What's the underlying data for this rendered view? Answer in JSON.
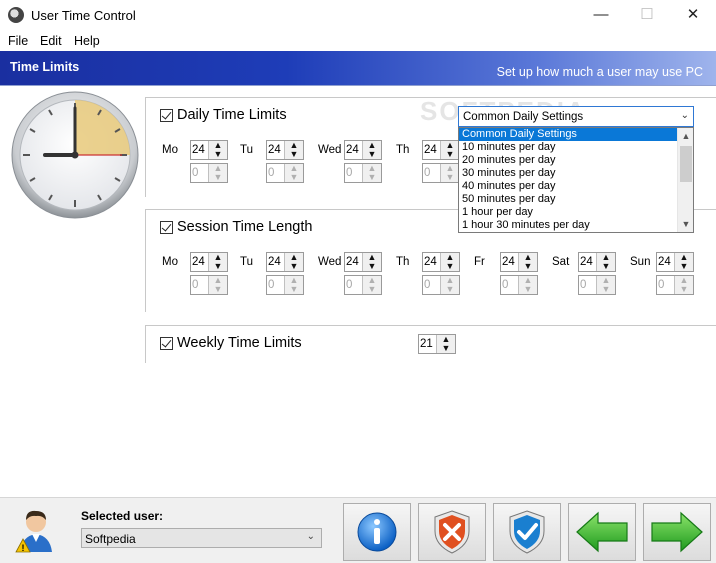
{
  "window": {
    "title": "User Time Control",
    "min_glyph": "—",
    "max_glyph": "☐",
    "close_glyph": "✕"
  },
  "menu": [
    {
      "label": "File"
    },
    {
      "label": "Edit"
    },
    {
      "label": "Help"
    }
  ],
  "header": {
    "title": "Time Limits",
    "subtitle": "Set up how much a user may use PC"
  },
  "watermark": "SOFTPEDIA",
  "daily": {
    "label": "Daily Time Limits",
    "checked": true,
    "days": [
      {
        "label": "Mo",
        "hours": "24",
        "minutes": "0"
      },
      {
        "label": "Tu",
        "hours": "24",
        "minutes": "0"
      },
      {
        "label": "Wed",
        "hours": "24",
        "minutes": "0"
      },
      {
        "label": "Th",
        "hours": "24",
        "minutes": "0"
      }
    ],
    "preset": {
      "value": "Common Daily Settings",
      "options": [
        "Common Daily Settings",
        "10 minutes per day",
        "20 minutes per day",
        "30 minutes per day",
        "40 minutes per day",
        "50 minutes per day",
        "1 hour per day",
        "1 hour 30 minutes per day"
      ],
      "selected_index": 0
    }
  },
  "session": {
    "label": "Session Time Length",
    "checked": true,
    "days": [
      {
        "label": "Mo",
        "hours": "24",
        "minutes": "0"
      },
      {
        "label": "Tu",
        "hours": "24",
        "minutes": "0"
      },
      {
        "label": "Wed",
        "hours": "24",
        "minutes": "0"
      },
      {
        "label": "Th",
        "hours": "24",
        "minutes": "0"
      },
      {
        "label": "Fr",
        "hours": "24",
        "minutes": "0"
      },
      {
        "label": "Sat",
        "hours": "24",
        "minutes": "0"
      },
      {
        "label": "Sun",
        "hours": "24",
        "minutes": "0"
      }
    ]
  },
  "weekly": {
    "label": "Weekly Time Limits",
    "checked": true,
    "value": "21"
  },
  "bottom": {
    "selected_user_label": "Selected user:",
    "selected_user": "Softpedia",
    "buttons": [
      {
        "name": "info-button",
        "icon": "info-icon"
      },
      {
        "name": "cancel-button",
        "icon": "shield-x-icon"
      },
      {
        "name": "apply-button",
        "icon": "shield-check-icon"
      },
      {
        "name": "back-button",
        "icon": "arrow-left-icon"
      },
      {
        "name": "next-button",
        "icon": "arrow-right-icon"
      }
    ]
  },
  "colors": {
    "header_start": "#1a2fa0",
    "header_end": "#9fb4ec",
    "selection": "#0a78d7",
    "arrow_green": "#2fb82f"
  }
}
